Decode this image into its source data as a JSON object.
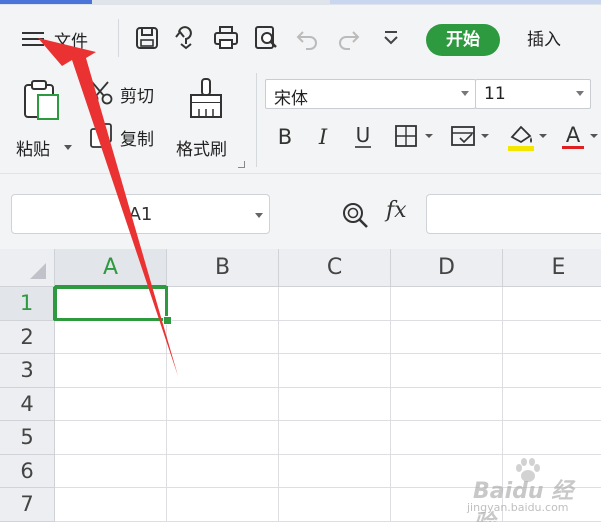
{
  "quick_access": {
    "menu_label": "文件",
    "tab_start": "开始",
    "tab_insert": "插入",
    "icons": [
      "save-icon",
      "save-as-icon",
      "print-icon",
      "print-preview-icon",
      "undo-icon",
      "redo-icon",
      "customize-chevron-icon"
    ]
  },
  "ribbon": {
    "paste_label": "粘贴",
    "cut_label": "剪切",
    "copy_label": "复制",
    "format_painter_label": "格式刷",
    "font_name": "宋体",
    "font_size": "11",
    "bold_icon": "B",
    "italic_icon": "I",
    "underline_icon": "U",
    "font_color_icon": "A",
    "colors": {
      "accent_green": "#2e9a3f",
      "highlight_yellow": "#f5e600",
      "font_red": "#e02020",
      "annotation_red": "#ea3232"
    }
  },
  "formula_bar": {
    "name_box": "A1",
    "fx_label": "fx",
    "formula_value": ""
  },
  "grid": {
    "columns": [
      "A",
      "B",
      "C",
      "D",
      "E"
    ],
    "rows": [
      "1",
      "2",
      "3",
      "4",
      "5",
      "6",
      "7"
    ],
    "selected_cell": "A1"
  },
  "watermark": {
    "text": "Baidu 经验",
    "subtext": "jingyan.baidu.com"
  }
}
